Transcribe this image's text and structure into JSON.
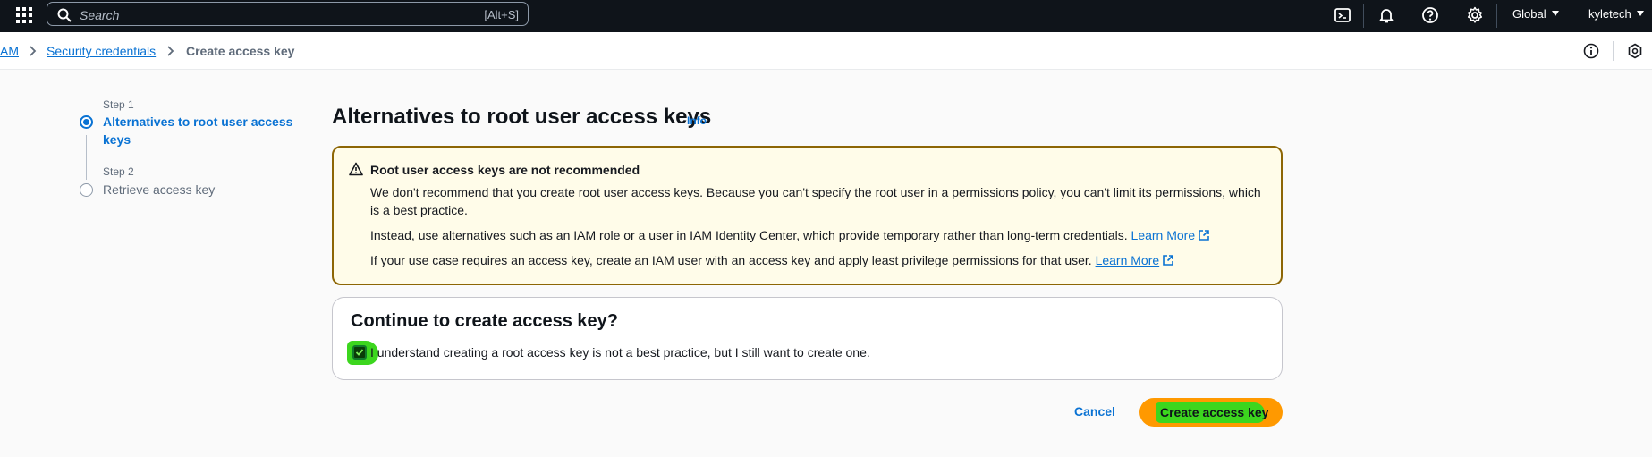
{
  "topnav": {
    "search_placeholder": "Search",
    "search_shortcut": "[Alt+S]",
    "region": "Global",
    "account": "kyletech"
  },
  "breadcrumb": {
    "items": [
      "AM",
      "Security credentials"
    ],
    "current": "Create access key"
  },
  "steps": [
    {
      "label": "Step 1",
      "title": "Alternatives to root user access keys",
      "state": "active"
    },
    {
      "label": "Step 2",
      "title": "Retrieve access key",
      "state": "inactive"
    }
  ],
  "main": {
    "title": "Alternatives to root user access keys",
    "info_link": "Info",
    "alert": {
      "title": "Root user access keys are not recommended",
      "p1": "We don't recommend that you create root user access keys. Because you can't specify the root user in a permissions policy, you can't limit its permissions, which is a best practice.",
      "p2": "Instead, use alternatives such as an IAM role or a user in IAM Identity Center, which provide temporary rather than long-term credentials.",
      "p3": "If your use case requires an access key, create an IAM user with an access key and apply least privilege permissions for that user.",
      "learn_more": "Learn More"
    },
    "continue": {
      "title": "Continue to create access key?",
      "checkbox_label": "I understand creating a root access key is not a best practice, but I still want to create one.",
      "checked": true
    },
    "cancel_label": "Cancel",
    "create_label": "Create access key"
  },
  "colors": {
    "accent": "#0972d3",
    "primary_button": "#ff9900",
    "highlight": "#3cd61e",
    "warning_border": "#8d6605",
    "topnav_bg": "#0f141a"
  }
}
